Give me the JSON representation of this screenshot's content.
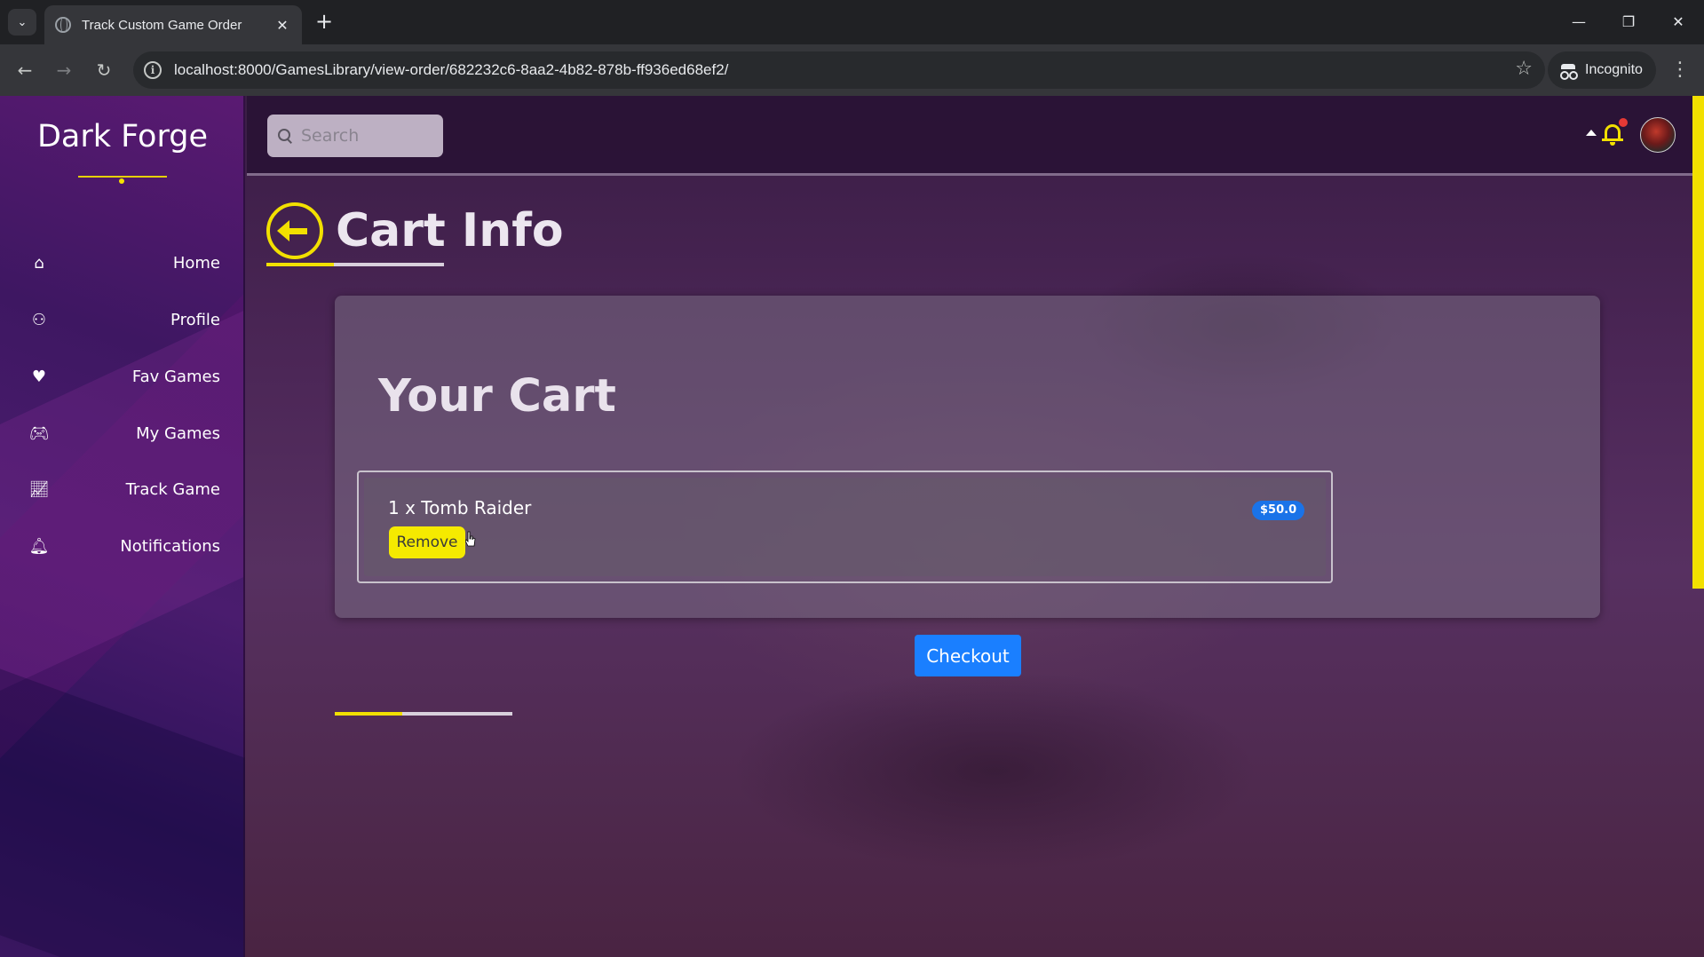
{
  "browser": {
    "tab_title": "Track Custom Game Order",
    "url": "localhost:8000/GamesLibrary/view-order/682232c6-8aa2-4b82-878b-ff936ed68ef2/",
    "incognito_label": "Incognito"
  },
  "sidebar": {
    "brand": "Dark Forge",
    "items": [
      {
        "label": "Home",
        "icon": "home-icon"
      },
      {
        "label": "Profile",
        "icon": "user-icon"
      },
      {
        "label": "Fav Games",
        "icon": "heart-icon"
      },
      {
        "label": "My Games",
        "icon": "gamepad-icon"
      },
      {
        "label": "Track Game",
        "icon": "chart-line-icon"
      },
      {
        "label": "Notifications",
        "icon": "bell-icon"
      }
    ]
  },
  "topbar": {
    "search_placeholder": "Search"
  },
  "page": {
    "title": "Cart Info"
  },
  "cart": {
    "heading": "Your Cart",
    "items": [
      {
        "name": "1 x Tomb Raider",
        "price": "$50.0",
        "remove_label": "Remove"
      }
    ],
    "checkout_label": "Checkout"
  },
  "colors": {
    "accent": "#f2e000",
    "primary": "#1a7fff",
    "sidebar": "#3e1762"
  }
}
